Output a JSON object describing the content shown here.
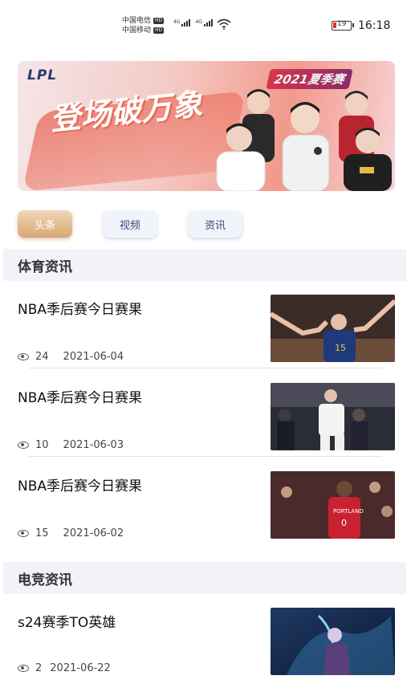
{
  "status_bar": {
    "carrier_1": "中国电信",
    "carrier_2": "中国移动",
    "hd": "HD",
    "network": "4G",
    "battery": "19",
    "time": "16:18"
  },
  "banner": {
    "logo": "LPL",
    "season": "2021夏季赛",
    "slogan": "登场破万象"
  },
  "tabs": [
    {
      "label": "头条",
      "active": true
    },
    {
      "label": "视频",
      "active": false
    },
    {
      "label": "资讯",
      "active": false
    }
  ],
  "sections": [
    {
      "title": "体育资讯",
      "items": [
        {
          "title": "NBA季后赛今日赛果",
          "views": "24",
          "date": "2021-06-04"
        },
        {
          "title": "NBA季后赛今日赛果",
          "views": "10",
          "date": "2021-06-03"
        },
        {
          "title": "NBA季后赛今日赛果",
          "views": "15",
          "date": "2021-06-02"
        }
      ]
    },
    {
      "title": "电竞资讯",
      "items": [
        {
          "title": "s24赛季TO英雄",
          "views": "2",
          "date": "2021-06-22"
        }
      ]
    }
  ],
  "colors": {
    "accent_tab": "#d9a774",
    "inactive_tab_text": "#3a4a7a",
    "section_bg": "#f1f3f9"
  }
}
